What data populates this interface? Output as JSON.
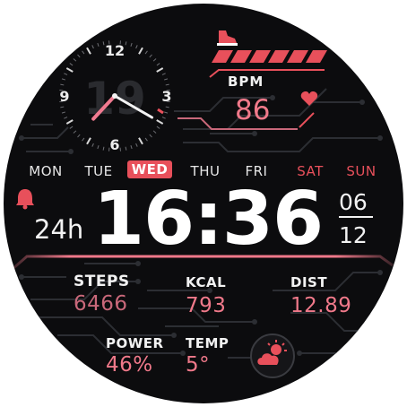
{
  "colors": {
    "accent": "#e8505b",
    "pink": "#f0798a",
    "dim_pink": "#c9687a",
    "text": "#f2f2f2",
    "circuit": "#2c2e33",
    "background": "#0c0c0e"
  },
  "analog": {
    "numerals": [
      "12",
      "3",
      "6",
      "9"
    ],
    "bg_day": "19",
    "hour_angle_deg": 223,
    "minute_angle_deg": 120
  },
  "heart_rate": {
    "label": "BPM",
    "value": "86",
    "icon": "heart-icon"
  },
  "steps_bar_segments": 6,
  "weekdays": [
    {
      "label": "MON",
      "state": "normal"
    },
    {
      "label": "TUE",
      "state": "normal"
    },
    {
      "label": "WED",
      "state": "selected"
    },
    {
      "label": "THU",
      "state": "normal"
    },
    {
      "label": "FRI",
      "state": "normal"
    },
    {
      "label": "SAT",
      "state": "weekend"
    },
    {
      "label": "SUN",
      "state": "weekend"
    }
  ],
  "time": {
    "digital": "16:36",
    "format": "24h",
    "alarm_icon": "bell-icon"
  },
  "date": {
    "day": "06",
    "month": "12"
  },
  "stats": {
    "steps": {
      "label": "STEPS",
      "value": "6466"
    },
    "kcal": {
      "label": "KCAL",
      "value": "793"
    },
    "dist": {
      "label": "DIST",
      "value": "12.89"
    },
    "power": {
      "label": "POWER",
      "value": "46%"
    },
    "temp": {
      "label": "TEMP",
      "value": "5°"
    }
  },
  "weather_icon": "cloud-sun-icon"
}
